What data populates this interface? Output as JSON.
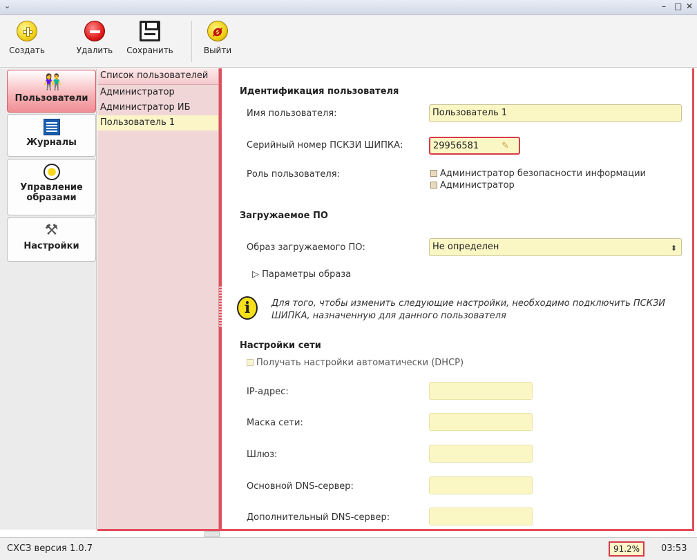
{
  "window": {
    "menu_glyph": "⌄",
    "minimize": "–",
    "maximize": "□",
    "close": "✕"
  },
  "toolbar": {
    "create": "Создать",
    "delete": "Удалить",
    "save": "Сохранить",
    "exit": "Выйти",
    "exit_glyph": "ø"
  },
  "sidebar": {
    "items": [
      {
        "label": "Пользователи",
        "icon": "users-icon",
        "active": true
      },
      {
        "label": "Журналы",
        "icon": "journal-icon"
      },
      {
        "label": "Управление образами",
        "icon": "images-icon"
      },
      {
        "label": "Настройки",
        "icon": "settings-icon"
      }
    ]
  },
  "userlist": {
    "header": "Список пользователей",
    "items": [
      "Администратор",
      "Администратор ИБ",
      "Пользователь 1"
    ],
    "selected": "Пользователь 1"
  },
  "identity": {
    "title": "Идентификация пользователя",
    "name_label": "Имя пользователя:",
    "name_value": "Пользователь 1",
    "serial_label": "Серийный номер ПСКЗИ ШИПКА:",
    "serial_value": "29956581",
    "role_label": "Роль пользователя:",
    "role_security_admin": "Администратор безопасности информации",
    "role_admin": "Администратор"
  },
  "software": {
    "title": "Загружаемое ПО",
    "image_label": "Образ загружаемого ПО:",
    "image_value": "Не определен",
    "params_label": "Параметры образа"
  },
  "info": {
    "text": "Для того, чтобы изменить следующие настройки, необходимо подключить ПСКЗИ ШИПКА, назначенную для данного пользователя"
  },
  "network": {
    "title": "Настройки сети",
    "dhcp_label": "Получать настройки автоматически (DHCP)",
    "ip_label": "IP-адрес:",
    "mask_label": "Маска сети:",
    "gateway_label": "Шлюз:",
    "dns1_label": "Основной DNS-сервер:",
    "dns2_label": "Дополнительный DNS-сервер:"
  },
  "status": {
    "version": "СХСЗ версия 1.0.7",
    "zoom": "91.2%",
    "clock": "03:53"
  },
  "colors": {
    "accent": "#e34c5a",
    "field_bg": "#fbf7c5",
    "active_nav": "#f08f95"
  }
}
